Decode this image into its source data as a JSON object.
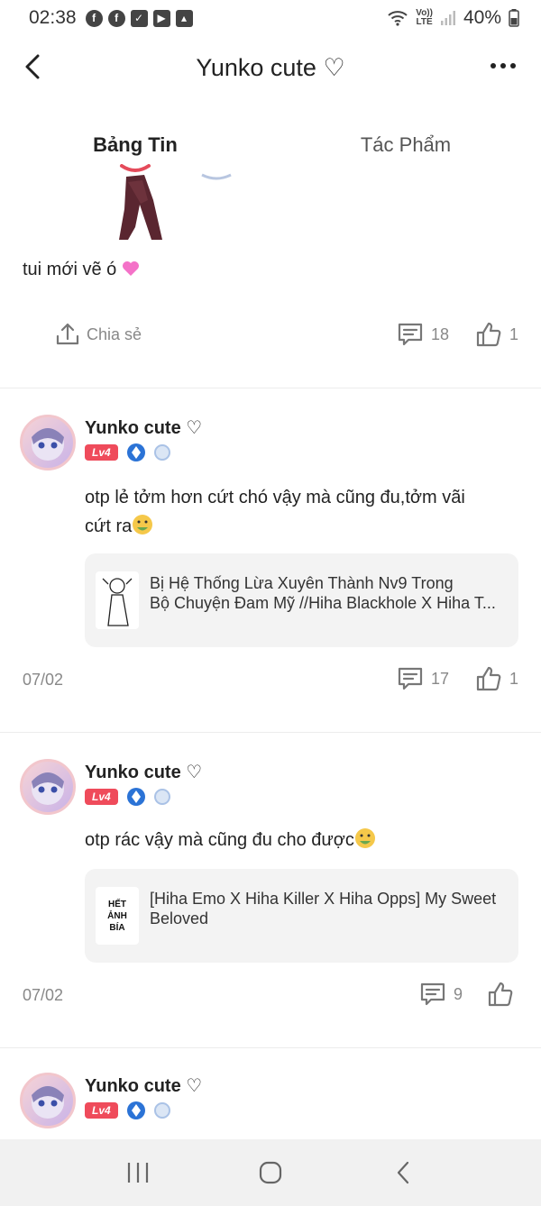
{
  "status": {
    "time": "02:38",
    "battery": "40%",
    "volte_top": "Vo))",
    "volte_bottom": "LTE"
  },
  "header": {
    "title": "Yunko cute ♡"
  },
  "tabs": [
    {
      "label": "Bảng Tin"
    },
    {
      "label": "Tác Phẩm"
    }
  ],
  "post": {
    "text": "tui mới vẽ ó",
    "share_label": "Chia sẻ",
    "comments": "18",
    "likes": "1"
  },
  "comments": [
    {
      "username": "Yunko cute ♡",
      "level": "Lv4",
      "text_line1": "otp lẻ tởm hơn cứt chó vậy mà cũng đu,tởm vãi",
      "text_line2": "cứt ra",
      "card_line1": "Bị Hệ Thống Lừa Xuyên Thành Nv9 Trong",
      "card_line2": "Bộ Chuyện Đam Mỹ //Hiha Blackhole X Hiha T...",
      "date": "07/02",
      "comments": "17",
      "likes": "1"
    },
    {
      "username": "Yunko cute ♡",
      "level": "Lv4",
      "text_line1": "otp rác vậy mà cũng đu cho được",
      "card_line1": "[Hiha Emo X Hiha Killer X Hiha Opps] My Sweet",
      "card_line2": "Beloved",
      "thumb_text": "HẾT ẢNH BÍA",
      "date": "07/02",
      "comments": "9"
    },
    {
      "username": "Yunko cute ♡",
      "level": "Lv4"
    }
  ],
  "colors": {
    "level_badge": "#ef4b5b",
    "muted": "#888888",
    "card_bg": "#f3f3f3"
  }
}
